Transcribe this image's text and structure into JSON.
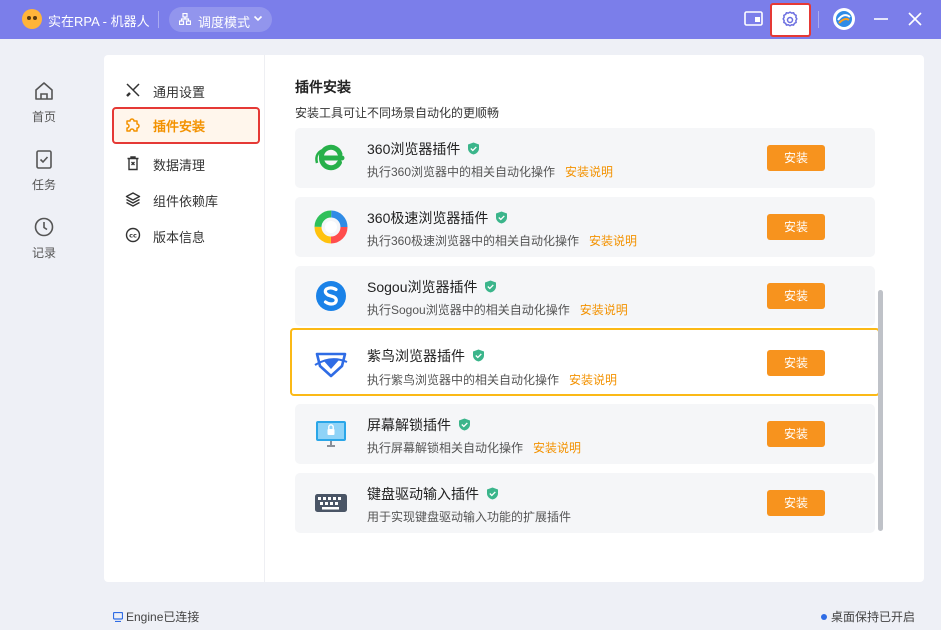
{
  "app": {
    "title": "实在RPA - 机器人",
    "mode_label": "调度模式",
    "icons": [
      "logo-icon",
      "scheduling-icon",
      "chevron-down-icon",
      "window-icon",
      "gear-icon",
      "avatar-icon",
      "minimize-icon",
      "close-icon"
    ]
  },
  "nav": {
    "items": [
      {
        "label": "首页",
        "icon": "home-icon"
      },
      {
        "label": "任务",
        "icon": "task-icon"
      },
      {
        "label": "记录",
        "icon": "clock-icon"
      }
    ]
  },
  "settings_menu": {
    "items": [
      {
        "label": "通用设置",
        "icon": "tools-icon"
      },
      {
        "label": "插件安装",
        "icon": "puzzle-icon",
        "active": true
      },
      {
        "label": "数据清理",
        "icon": "trash-icon"
      },
      {
        "label": "组件依赖库",
        "icon": "layers-icon"
      },
      {
        "label": "版本信息",
        "icon": "copyright-icon"
      }
    ]
  },
  "plugins": {
    "title": "插件安装",
    "subtitle": "安装工具可让不同场景自动化的更顺畅",
    "items": [
      {
        "name": "360浏览器插件",
        "desc": "执行360浏览器中的相关自动化操作",
        "link": "安装说明",
        "button": "安装",
        "icon": "browser-360-icon"
      },
      {
        "name": "360极速浏览器插件",
        "desc": "执行360极速浏览器中的相关自动化操作",
        "link": "安装说明",
        "button": "安装",
        "icon": "browser-360-speed-icon"
      },
      {
        "name": "Sogou浏览器插件",
        "desc": "执行Sogou浏览器中的相关自动化操作",
        "link": "安装说明",
        "button": "安装",
        "icon": "browser-sogou-icon"
      },
      {
        "name": "紫鸟浏览器插件",
        "desc": "执行紫鸟浏览器中的相关自动化操作",
        "link": "安装说明",
        "button": "安装",
        "icon": "browser-ziniao-icon",
        "highlighted": true
      },
      {
        "name": "屏幕解锁插件",
        "desc": "执行屏幕解锁相关自动化操作",
        "link": "安装说明",
        "button": "安装",
        "icon": "screen-unlock-icon"
      },
      {
        "name": "键盘驱动输入插件",
        "desc": "用于实现键盘驱动输入功能的扩展插件",
        "link": "",
        "button": "安装",
        "icon": "keyboard-icon"
      }
    ]
  },
  "status": {
    "engine": "Engine已连接",
    "desktop": "桌面保持已开启"
  },
  "colors": {
    "titlebar": "#7b7eea",
    "accent": "#f7931e",
    "highlight_border": "#fbb916",
    "red_outline": "#e53935",
    "verified": "#3bb58b"
  }
}
